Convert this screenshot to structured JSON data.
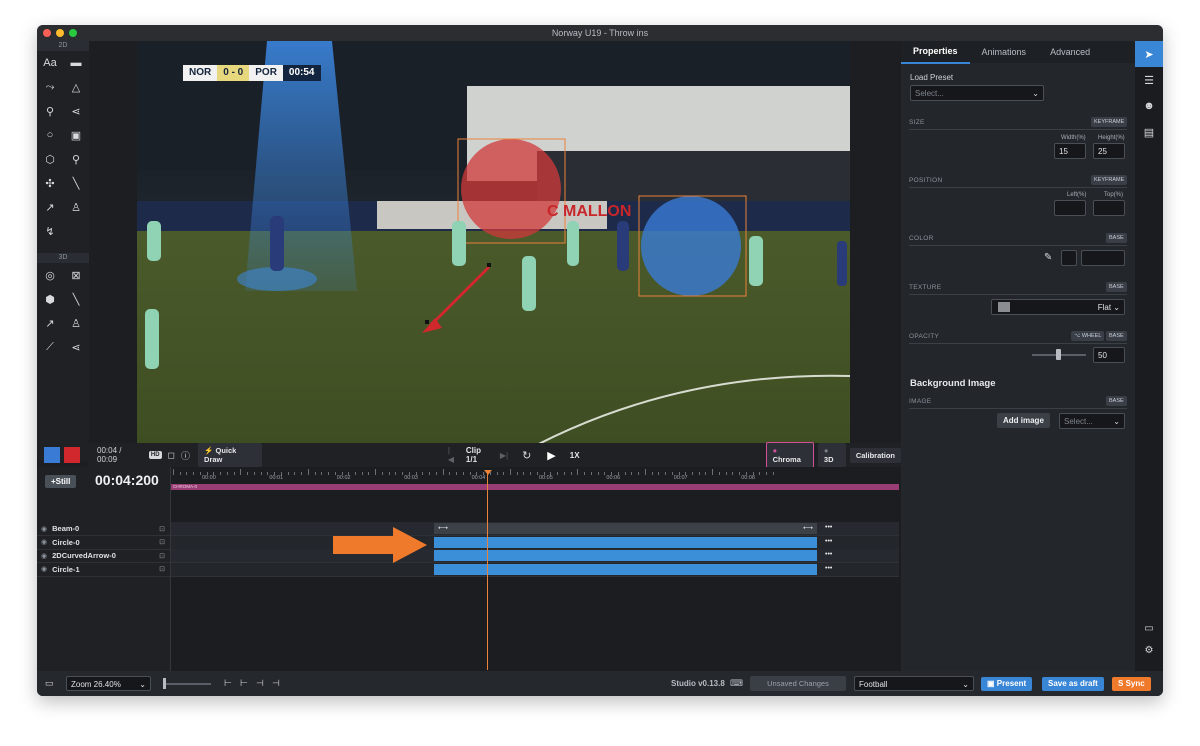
{
  "window": {
    "title": "Norway U19 - Throw ins"
  },
  "left_toolbar": {
    "label_2d": "2D",
    "label_3d": "3D",
    "tools_2d": [
      {
        "name": "text-tool-icon",
        "glyph": "Aa"
      },
      {
        "name": "comment-tool-icon",
        "glyph": "▬"
      },
      {
        "name": "freehand-tool-icon",
        "glyph": "⤳"
      },
      {
        "name": "cone-tool-icon",
        "glyph": "△"
      },
      {
        "name": "player-tool-icon",
        "glyph": "⚲"
      },
      {
        "name": "connect-tool-icon",
        "glyph": "⋖"
      },
      {
        "name": "circle-tool-icon",
        "glyph": "○"
      },
      {
        "name": "image-tool-icon",
        "glyph": "▣"
      },
      {
        "name": "polygon-tool-icon",
        "glyph": "⬡"
      },
      {
        "name": "magnifier-tool-icon",
        "glyph": "⚲"
      },
      {
        "name": "move-tool-icon",
        "glyph": "✣"
      },
      {
        "name": "line-tool-icon",
        "glyph": "╲"
      },
      {
        "name": "arrow-tool-icon",
        "glyph": "↗"
      },
      {
        "name": "stamp-tool-icon",
        "glyph": "♙"
      },
      {
        "name": "curve-tool-icon",
        "glyph": "↯"
      }
    ],
    "tools_3d": [
      {
        "name": "ring-3d-icon",
        "glyph": "◎"
      },
      {
        "name": "box-3d-icon",
        "glyph": "⊠"
      },
      {
        "name": "polygon-3d-icon",
        "glyph": "⬢"
      },
      {
        "name": "line-3d-icon",
        "glyph": "╲"
      },
      {
        "name": "arrow-3d-icon",
        "glyph": "↗"
      },
      {
        "name": "player-3d-icon",
        "glyph": "♙"
      },
      {
        "name": "ruler-3d-icon",
        "glyph": "⟋"
      },
      {
        "name": "connect-3d-icon",
        "glyph": "⋖"
      }
    ],
    "colors": [
      "#3a7bd5",
      "#d0282d"
    ]
  },
  "video": {
    "scoreboard": {
      "home": "NOR",
      "score": "0 - 0",
      "away": "POR",
      "time": "00:54"
    },
    "billboard_text": "C MALLON"
  },
  "controls": {
    "time": "00:04 / 00:09",
    "hd": "HD",
    "quick_draw": "Quick Draw",
    "clip": "Clip 1/1",
    "speed": "1X",
    "chroma": "Chroma",
    "three_d": "3D",
    "calibration": "Calibration"
  },
  "properties": {
    "tabs": [
      "Properties",
      "Animations",
      "Advanced"
    ],
    "load_preset_label": "Load Preset",
    "load_preset_placeholder": "Select...",
    "size_label": "SIZE",
    "keyframe": "KEYFRAME",
    "width_label": "Width(%)",
    "height_label": "Height(%)",
    "width": "15",
    "height": "25",
    "position_label": "POSITION",
    "left_label": "Left(%)",
    "top_label": "Top(%)",
    "color_label": "COLOR",
    "base": "BASE",
    "texture_label": "TEXTURE",
    "texture_value": "Flat",
    "opacity_label": "OPACITY",
    "wheel": "⌥ WHEEL",
    "opacity": "50",
    "bg_image_title": "Background Image",
    "image_label": "IMAGE",
    "add_image": "Add image",
    "select_placeholder": "Select..."
  },
  "timeline": {
    "still_button": "+Still",
    "current_time": "00:04:200",
    "ticks": [
      "00:00",
      "00:01",
      "00:02",
      "00:03",
      "00:04",
      "00:05",
      "00:06",
      "00:07",
      "00:08"
    ],
    "chroma_label": "CHROMA-0",
    "tracks": [
      "Beam-0",
      "Circle-0",
      "2DCurvedArrow-0",
      "Circle-1"
    ],
    "more": "•••"
  },
  "bottom": {
    "zoom": "Zoom 26.40%",
    "version": "Studio v0.13.8",
    "unsaved": "Unsaved Changes",
    "sport": "Football",
    "present": "Present",
    "save_draft": "Save as draft",
    "sync": "Sync"
  }
}
